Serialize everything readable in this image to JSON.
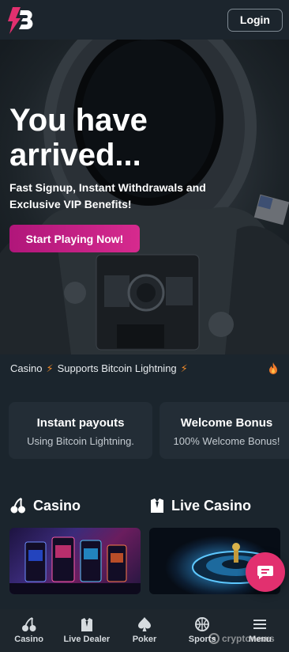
{
  "header": {
    "login_label": "Login"
  },
  "hero": {
    "title": "You have arrived...",
    "subtitle": "Fast Signup, Instant Withdrawals and Exclusive VIP Benefits!",
    "cta_label": "Start Playing Now!"
  },
  "ticker": {
    "item_1": "Casino",
    "item_2": "Supports Bitcoin Lightning"
  },
  "features": [
    {
      "title": "Instant payouts",
      "text": "Using Bitcoin Lightning."
    },
    {
      "title": "Welcome Bonus",
      "text": "100% Welcome Bonus!"
    }
  ],
  "sections": {
    "casino": "Casino",
    "live_casino": "Live Casino"
  },
  "bottom_nav": [
    {
      "label": "Casino",
      "icon": "cherries-icon"
    },
    {
      "label": "Live Dealer",
      "icon": "live-dealer-icon"
    },
    {
      "label": "Poker",
      "icon": "spade-icon"
    },
    {
      "label": "Sports",
      "icon": "basketball-icon"
    },
    {
      "label": "Menu",
      "icon": "hamburger-icon"
    }
  ],
  "watermark": "cryptonews",
  "colors": {
    "accent": "#d62a8e",
    "chat": "#e2306f",
    "bolt": "#f08a2a",
    "background": "#1b252d"
  }
}
